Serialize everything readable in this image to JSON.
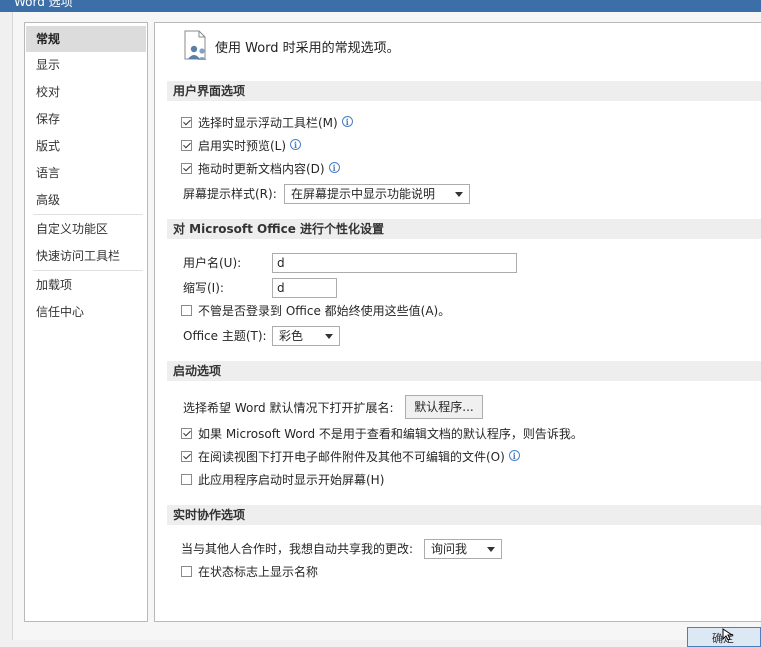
{
  "window": {
    "title": "Word 选项"
  },
  "sidebar": {
    "items": [
      {
        "label": "常规"
      },
      {
        "label": "显示"
      },
      {
        "label": "校对"
      },
      {
        "label": "保存"
      },
      {
        "label": "版式"
      },
      {
        "label": "语言"
      },
      {
        "label": "高级"
      },
      {
        "label": "自定义功能区"
      },
      {
        "label": "快速访问工具栏"
      },
      {
        "label": "加载项"
      },
      {
        "label": "信任中心"
      }
    ],
    "selected": "常规"
  },
  "header": {
    "text": "使用 Word 时采用的常规选项。",
    "icon": "general-options-icon"
  },
  "ui_options": {
    "title": "用户界面选项",
    "mini_toolbar": {
      "label": "选择时显示浮动工具栏(M)",
      "checked": true
    },
    "live_preview": {
      "label": "启用实时预览(L)",
      "checked": true
    },
    "update_while_drag": {
      "label": "拖动时更新文档内容(D)",
      "checked": true
    },
    "screentip_label": "屏幕提示样式(R):",
    "screentip_value": "在屏幕提示中显示功能说明"
  },
  "personalize": {
    "title": "对 Microsoft Office 进行个性化设置",
    "username_label": "用户名(U):",
    "username_value": "d",
    "initials_label": "缩写(I):",
    "initials_value": "d",
    "always_use": {
      "label": "不管是否登录到 Office 都始终使用这些值(A)。",
      "checked": false
    },
    "theme_label": "Office 主题(T):",
    "theme_value": "彩色"
  },
  "startup": {
    "title": "启动选项",
    "ext_label": "选择希望 Word 默认情况下打开扩展名:",
    "default_programs_button": "默认程序...",
    "tell_me": {
      "label": "如果 Microsoft Word 不是用于查看和编辑文档的默认程序，则告诉我。",
      "checked": true
    },
    "reading_view": {
      "label": "在阅读视图下打开电子邮件附件及其他不可编辑的文件(O)",
      "checked": true
    },
    "start_screen": {
      "label": "此应用程序启动时显示开始屏幕(H)",
      "checked": false
    }
  },
  "coauthoring": {
    "title": "实时协作选项",
    "share_label": "当与其他人合作时，我想自动共享我的更改:",
    "share_value": "询问我",
    "show_names": {
      "label": "在状态标志上显示名称",
      "checked": false
    }
  },
  "footer": {
    "ok_label": "确定"
  }
}
